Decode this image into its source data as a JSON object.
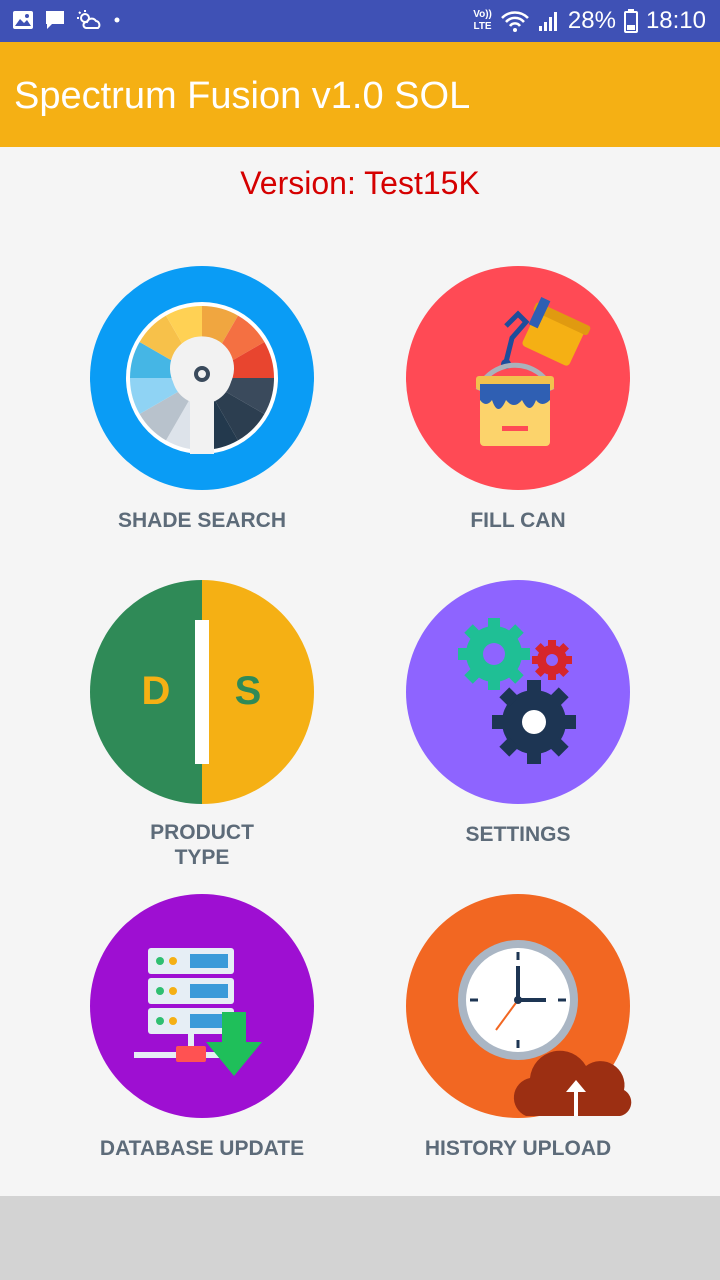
{
  "status_bar": {
    "volte_top": "Vo))",
    "volte_bottom": "LTE",
    "battery_percent": "28%",
    "time": "18:10",
    "icons": [
      "gallery-icon",
      "message-icon",
      "weather-icon",
      "dot-icon",
      "wifi-icon",
      "signal-icon",
      "battery-icon"
    ]
  },
  "app_bar": {
    "title": "Spectrum Fusion v1.0 SOL"
  },
  "version_text": "Version: Test15K",
  "colors": {
    "status_bar": "#3f51b5",
    "app_bar": "#f5b014",
    "version_text": "#d50000",
    "label_text": "#5d6b79",
    "shade_search_ring": "#0a9cf5",
    "fill_can": "#ff4a55",
    "product_type_left": "#2f8a57",
    "product_type_right": "#f5b014",
    "settings": "#8e64ff",
    "database_update": "#9e0fd2",
    "history_upload": "#f26722"
  },
  "menu": {
    "shade_search": {
      "label": "SHADE SEARCH",
      "icon": "color-wheel-icon"
    },
    "fill_can": {
      "label": "FILL CAN",
      "icon": "paint-bucket-icon"
    },
    "product_type": {
      "label_line1": "PRODUCT",
      "label_line2": "TYPE",
      "icon_left_letter": "D",
      "icon_right_letter": "S",
      "icon": "product-type-icon"
    },
    "settings": {
      "label": "SETTINGS",
      "icon": "gears-icon"
    },
    "database_update": {
      "label": "DATABASE UPDATE",
      "icon": "database-download-icon"
    },
    "history_upload": {
      "label": "HISTORY UPLOAD",
      "icon": "clock-upload-icon"
    }
  }
}
